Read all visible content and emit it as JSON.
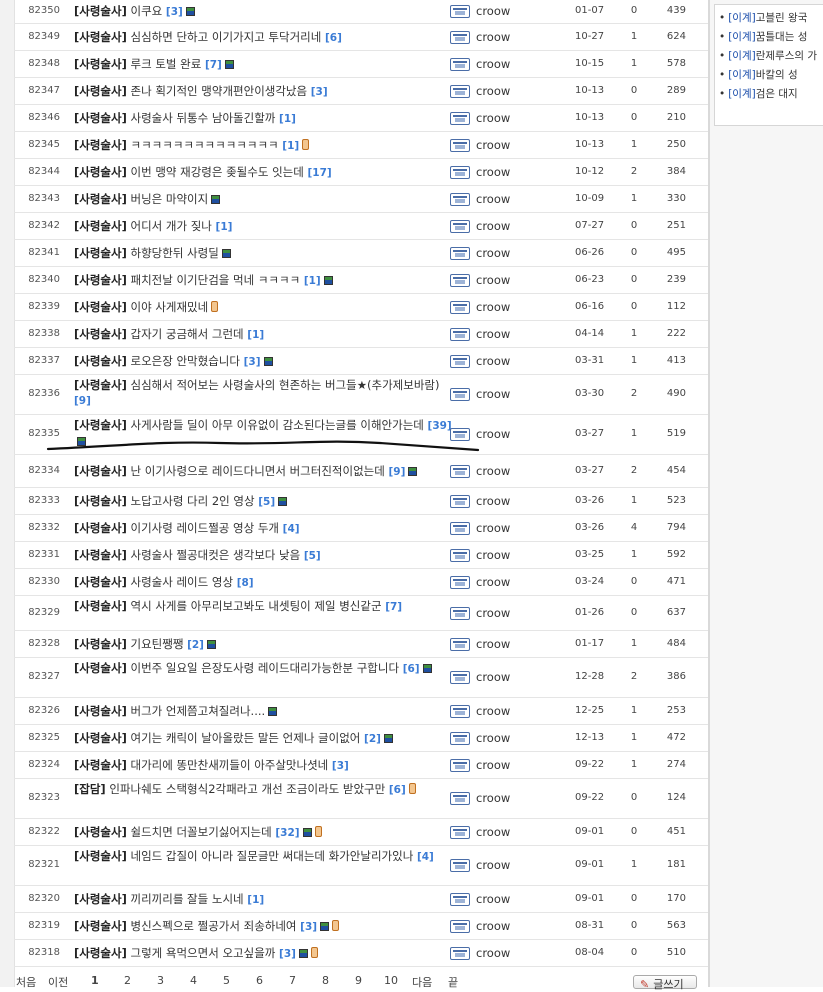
{
  "posts": [
    {
      "num": "82350",
      "cat": "[사령술사]",
      "title": "이쿠요",
      "comments": "[3]",
      "icons": [
        "image"
      ],
      "author": "croow",
      "date": "01-07",
      "rec": "0",
      "views": "439"
    },
    {
      "num": "82349",
      "cat": "[사령술사]",
      "title": "심심하면 단하고 이기가지고 투닥거리네",
      "comments": "[6]",
      "icons": [],
      "author": "croow",
      "date": "10-27",
      "rec": "1",
      "views": "624"
    },
    {
      "num": "82348",
      "cat": "[사령술사]",
      "title": "루크 토벌 완료",
      "comments": "[7]",
      "icons": [
        "image"
      ],
      "author": "croow",
      "date": "10-15",
      "rec": "1",
      "views": "578"
    },
    {
      "num": "82347",
      "cat": "[사령술사]",
      "title": "존나 획기적인 맹약개편안이생각났음",
      "comments": "[3]",
      "icons": [],
      "author": "croow",
      "date": "10-13",
      "rec": "0",
      "views": "289"
    },
    {
      "num": "82346",
      "cat": "[사령술사]",
      "title": "사령술사 뒤통수 남아돌긴할까",
      "comments": "[1]",
      "icons": [],
      "author": "croow",
      "date": "10-13",
      "rec": "0",
      "views": "210"
    },
    {
      "num": "82345",
      "cat": "[사령술사]",
      "title": "ㅋㅋㅋㅋㅋㅋㅋㅋㅋㅋㅋㅋㅋㅋ",
      "comments": "[1]",
      "icons": [
        "phone"
      ],
      "author": "croow",
      "date": "10-13",
      "rec": "1",
      "views": "250"
    },
    {
      "num": "82344",
      "cat": "[사령술사]",
      "title": "이번 맹약 재강령은 좆될수도 잇는데",
      "comments": "[17]",
      "icons": [],
      "author": "croow",
      "date": "10-12",
      "rec": "2",
      "views": "384"
    },
    {
      "num": "82343",
      "cat": "[사령술사]",
      "title": "버닝은 마약이지",
      "comments": "",
      "icons": [
        "image"
      ],
      "author": "croow",
      "date": "10-09",
      "rec": "1",
      "views": "330"
    },
    {
      "num": "82342",
      "cat": "[사령술사]",
      "title": "어디서 개가 짖나",
      "comments": "[1]",
      "icons": [],
      "author": "croow",
      "date": "07-27",
      "rec": "0",
      "views": "251"
    },
    {
      "num": "82341",
      "cat": "[사령술사]",
      "title": "하향당한뒤 사령딜",
      "comments": "",
      "icons": [
        "image"
      ],
      "author": "croow",
      "date": "06-26",
      "rec": "0",
      "views": "495"
    },
    {
      "num": "82340",
      "cat": "[사령술사]",
      "title": "패치전날 이기단검을 먹네 ㅋㅋㅋㅋ",
      "comments": "[1]",
      "icons": [
        "image"
      ],
      "author": "croow",
      "date": "06-23",
      "rec": "0",
      "views": "239"
    },
    {
      "num": "82339",
      "cat": "[사령술사]",
      "title": "이야 사게재밌네",
      "comments": "",
      "icons": [
        "phone"
      ],
      "author": "croow",
      "date": "06-16",
      "rec": "0",
      "views": "112"
    },
    {
      "num": "82338",
      "cat": "[사령술사]",
      "title": "갑자기 궁금해서 그런데",
      "comments": "[1]",
      "icons": [],
      "author": "croow",
      "date": "04-14",
      "rec": "1",
      "views": "222"
    },
    {
      "num": "82337",
      "cat": "[사령술사]",
      "title": "로오은장 안막혔습니다",
      "comments": "[3]",
      "icons": [
        "image"
      ],
      "author": "croow",
      "date": "03-31",
      "rec": "1",
      "views": "413"
    },
    {
      "num": "82336",
      "cat": "[사령술사]",
      "title": "심심해서 적어보는 사령술사의 현존하는 버그들★(추가제보바람)",
      "comments": "[9]",
      "icons": [],
      "author": "croow",
      "date": "03-30",
      "rec": "2",
      "views": "490"
    },
    {
      "num": "82335",
      "cat": "[사령술사]",
      "title": "사게사람들 딜이 아무 이유없이 감소된다는글를 이해안가는데",
      "comments": "[39]",
      "icons": [
        "image"
      ],
      "author": "croow",
      "date": "03-27",
      "rec": "1",
      "views": "519"
    },
    {
      "num": "82334",
      "cat": "[사령술사]",
      "title": "난 이기사령으로 레이드다니면서 버그터진적이없는데",
      "comments": "[9]",
      "icons": [
        "image"
      ],
      "author": "croow",
      "date": "03-27",
      "rec": "2",
      "views": "454"
    },
    {
      "num": "82333",
      "cat": "[사령술사]",
      "title": "노답고사령 다리 2인 영상",
      "comments": "[5]",
      "icons": [
        "image"
      ],
      "author": "croow",
      "date": "03-26",
      "rec": "1",
      "views": "523"
    },
    {
      "num": "82332",
      "cat": "[사령술사]",
      "title": "이기사령 레이드쩔공 영상 두개",
      "comments": "[4]",
      "icons": [],
      "author": "croow",
      "date": "03-26",
      "rec": "4",
      "views": "794"
    },
    {
      "num": "82331",
      "cat": "[사령술사]",
      "title": "사령술사 쩔공대컷은 생각보다 낮음",
      "comments": "[5]",
      "icons": [],
      "author": "croow",
      "date": "03-25",
      "rec": "1",
      "views": "592"
    },
    {
      "num": "82330",
      "cat": "[사령술사]",
      "title": "사령술사 레이드 영상",
      "comments": "[8]",
      "icons": [],
      "author": "croow",
      "date": "03-24",
      "rec": "0",
      "views": "471"
    },
    {
      "num": "82329",
      "cat": "[사령술사]",
      "title": "역시 사게를 아무리보고봐도 내셋팅이 제일 병신같군",
      "comments": "[7]",
      "icons": [],
      "author": "croow",
      "date": "01-26",
      "rec": "0",
      "views": "637"
    },
    {
      "num": "82328",
      "cat": "[사령술사]",
      "title": "기요틴쨍쨍",
      "comments": "[2]",
      "icons": [
        "image"
      ],
      "author": "croow",
      "date": "01-17",
      "rec": "1",
      "views": "484"
    },
    {
      "num": "82327",
      "cat": "[사령술사]",
      "title": "이번주 일요일 은장도사령 레이드대리가능한분 구합니다",
      "comments": "[6]",
      "icons": [
        "image"
      ],
      "author": "croow",
      "date": "12-28",
      "rec": "2",
      "views": "386"
    },
    {
      "num": "82326",
      "cat": "[사령술사]",
      "title": "버그가 언제쯤고쳐질려나....",
      "comments": "",
      "icons": [
        "image"
      ],
      "author": "croow",
      "date": "12-25",
      "rec": "1",
      "views": "253"
    },
    {
      "num": "82325",
      "cat": "[사령술사]",
      "title": "여기는 캐릭이 날아올랐든 말든 언제나 글이없어",
      "comments": "[2]",
      "icons": [
        "image"
      ],
      "author": "croow",
      "date": "12-13",
      "rec": "1",
      "views": "472"
    },
    {
      "num": "82324",
      "cat": "[사령술사]",
      "title": "대가리에 똥만찬새끼들이 아주살맛나셧네",
      "comments": "[3]",
      "icons": [],
      "author": "croow",
      "date": "09-22",
      "rec": "1",
      "views": "274"
    },
    {
      "num": "82323",
      "cat": "[잡담]",
      "title": "인파나쉐도 스택형식2각패라고 개선 조금이라도 받았구만",
      "comments": "[6]",
      "icons": [
        "phone"
      ],
      "author": "croow",
      "date": "09-22",
      "rec": "0",
      "views": "124"
    },
    {
      "num": "82322",
      "cat": "[사령술사]",
      "title": "쉴드치면 더꼴보기싫어지는데",
      "comments": "[32]",
      "icons": [
        "image",
        "phone"
      ],
      "author": "croow",
      "date": "09-01",
      "rec": "0",
      "views": "451"
    },
    {
      "num": "82321",
      "cat": "[사령술사]",
      "title": "네임드 갑질이 아니라 질문글만 써대는데 화가안날리가있나",
      "comments": "[4]",
      "icons": [],
      "author": "croow",
      "date": "09-01",
      "rec": "1",
      "views": "181"
    },
    {
      "num": "82320",
      "cat": "[사령술사]",
      "title": "끼리끼리를 잘들 노시네",
      "comments": "[1]",
      "icons": [],
      "author": "croow",
      "date": "09-01",
      "rec": "0",
      "views": "170"
    },
    {
      "num": "82319",
      "cat": "[사령술사]",
      "title": "병신스펙으로 쩔공가서 죄송하네여",
      "comments": "[3]",
      "icons": [
        "image",
        "phone"
      ],
      "author": "croow",
      "date": "08-31",
      "rec": "0",
      "views": "563"
    },
    {
      "num": "82318",
      "cat": "[사령술사]",
      "title": "그렇게 욕먹으면서 오고싶을까",
      "comments": "[3]",
      "icons": [
        "image",
        "phone"
      ],
      "author": "croow",
      "date": "08-04",
      "rec": "0",
      "views": "510"
    }
  ],
  "pagination": {
    "first": "처음",
    "prev": "이전",
    "pages": [
      "1",
      "2",
      "3",
      "4",
      "5",
      "6",
      "7",
      "8",
      "9",
      "10"
    ],
    "next": "다음",
    "last": "끝",
    "current": "1"
  },
  "write_button": "글쓰기",
  "sidebar": {
    "items": [
      {
        "tag": "[이계]",
        "text": "고블린 왕국"
      },
      {
        "tag": "[이계]",
        "text": "꿈틀대는 성"
      },
      {
        "tag": "[이계]",
        "text": "란제루스의 가"
      },
      {
        "tag": "[이계]",
        "text": "바칼의 성"
      },
      {
        "tag": "[이계]",
        "text": "검은 대지"
      }
    ]
  }
}
